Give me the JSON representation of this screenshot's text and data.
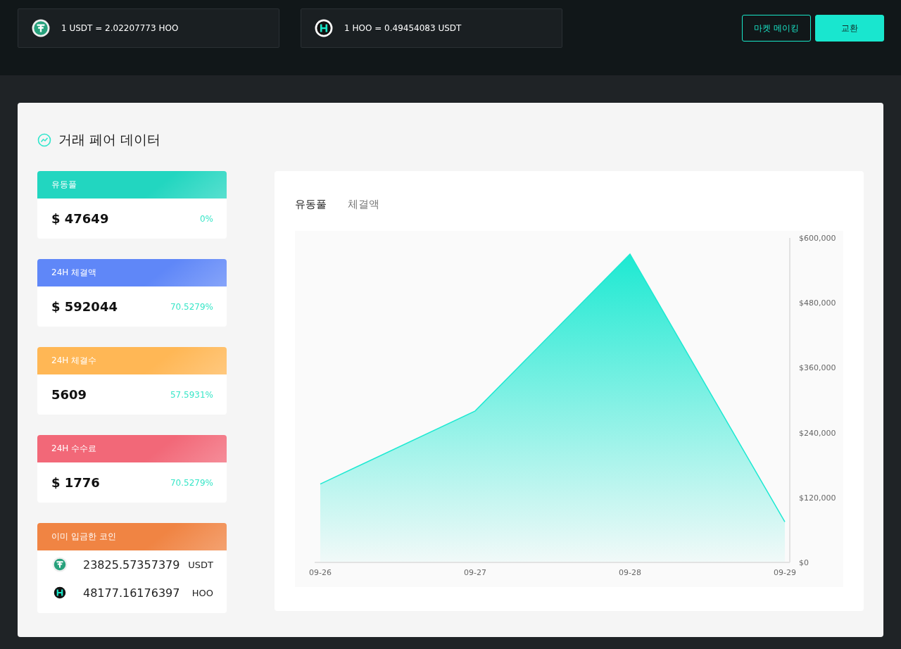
{
  "rates": [
    {
      "kind": "usdt",
      "text": "1 USDT = 2.02207773 HOO"
    },
    {
      "kind": "hoo",
      "text": "1 HOO = 0.49454083 USDT"
    }
  ],
  "actions": [
    {
      "label": "마켓 메이킹",
      "kind": "outline"
    },
    {
      "label": "교환",
      "kind": "filled"
    }
  ],
  "title": "거래 페어 데이터",
  "stats": [
    {
      "kind": "stat",
      "label": "유동풀",
      "color": "#22d6c0",
      "value": "$ 47649",
      "change": "0%"
    },
    {
      "kind": "stat",
      "label": "24H 체결액",
      "color": "#5f87f8",
      "value": "$ 592044",
      "change": "70.5279%"
    },
    {
      "kind": "stat",
      "label": "24H 체결수",
      "color": "#ffb755",
      "value": "5609",
      "change": "57.5931%"
    },
    {
      "kind": "stat",
      "label": "24H 수수료",
      "color": "#f26878",
      "value": "$ 1776",
      "change": "70.5279%"
    },
    {
      "kind": "coins",
      "label": "이미 입금한 코인",
      "color": "#f08443",
      "coins": [
        {
          "kind": "usdt",
          "amount": "23825.57357379",
          "symbol": "USDT"
        },
        {
          "kind": "hoo",
          "amount": "48177.16176397",
          "symbol": "HOO"
        }
      ]
    }
  ],
  "tabs": [
    {
      "label": "유동풀",
      "selected": true
    },
    {
      "label": "체결액",
      "selected": false
    }
  ],
  "chart_data": {
    "type": "area",
    "categories": [
      "09-26",
      "09-27",
      "09-28",
      "09-29"
    ],
    "series": [
      {
        "color": "#1de9d2",
        "values": [
          145000,
          280000,
          570000,
          75000
        ]
      }
    ],
    "ylim": [
      0,
      600000
    ],
    "yticks": [
      {
        "value": 0,
        "label": "$0"
      },
      {
        "value": 120000,
        "label": "$120,000"
      },
      {
        "value": 240000,
        "label": "$240,000"
      },
      {
        "value": 360000,
        "label": "$360,000"
      },
      {
        "value": 480000,
        "label": "$480,000"
      },
      {
        "value": 600000,
        "label": "$600,000"
      }
    ]
  }
}
